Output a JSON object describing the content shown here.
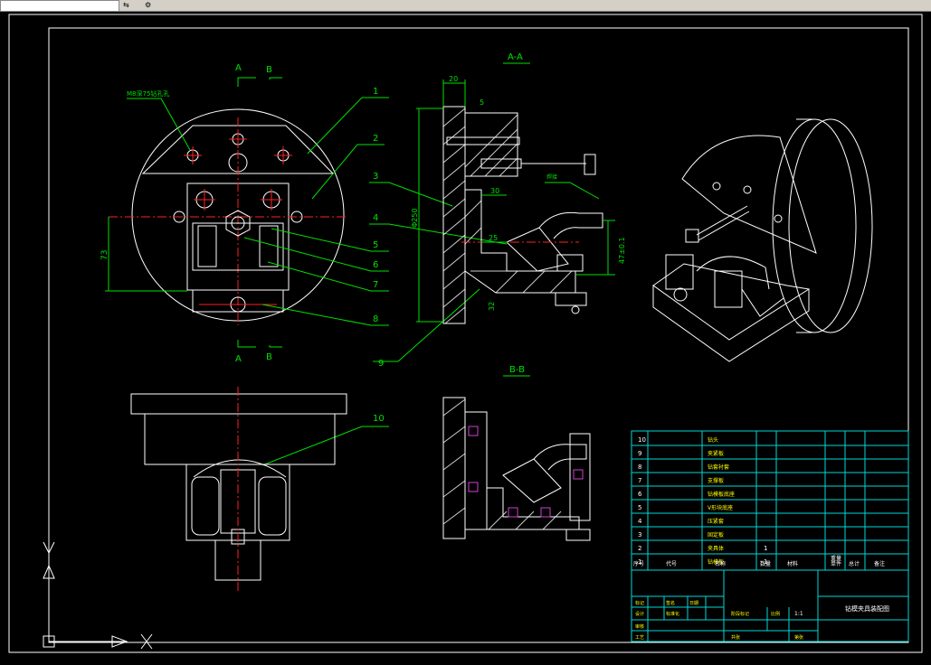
{
  "toolbar": {
    "search_text": "",
    "icons": [
      "arrow-icon",
      "gear-icon"
    ]
  },
  "colors": {
    "background": "#000000",
    "geometry": "#ffffff",
    "leaders": "#00e000",
    "center_lines": "#ff2020",
    "table": "#00d8d8",
    "dimensions": "#00e000"
  },
  "drawing": {
    "section_aa": "A-A",
    "section_bb": "B-B",
    "cut_a": "A",
    "cut_b": "B",
    "thread_note": "M8深75钻孔孔",
    "dims": {
      "d20": "20",
      "d5": "5",
      "d30": "30",
      "d25": "25",
      "d32": "32",
      "phi250": "Φ250",
      "h73": "73",
      "d47": "47±0.1"
    },
    "part_numbers": [
      "1",
      "2",
      "3",
      "4",
      "5",
      "6",
      "7",
      "8",
      "9",
      "10"
    ],
    "weld_note": "焊接"
  },
  "title_block": {
    "rows": [
      {
        "no": "10",
        "name": "钻头"
      },
      {
        "no": "9",
        "name": "夹紧板"
      },
      {
        "no": "8",
        "name": "钻套衬套"
      },
      {
        "no": "7",
        "name": "支撑板"
      },
      {
        "no": "6",
        "name": "钻模板底座"
      },
      {
        "no": "5",
        "name": "V形块底座"
      },
      {
        "no": "4",
        "name": "压紧套"
      },
      {
        "no": "3",
        "name": "固定板"
      },
      {
        "no": "2",
        "name": "夹具体",
        "qty": "1"
      },
      {
        "no": "1",
        "name": "钻模板",
        "qty": "1"
      }
    ],
    "header": [
      "序号",
      "代号",
      "名称",
      "数量",
      "材料",
      "单件",
      "总计",
      "备注"
    ],
    "weight": "重量",
    "title": "钻模夹具装配图",
    "label_design": "设计",
    "label_check": "审核",
    "label_process": "工艺",
    "label_stage": "阶段标记",
    "label_scale": "比例",
    "scale_value": "1:1",
    "label_sheet": "共张",
    "label_page": "第张",
    "label_std": "标准化",
    "label_sign": "签名",
    "label_date": "日期",
    "label_mark": "标记"
  }
}
